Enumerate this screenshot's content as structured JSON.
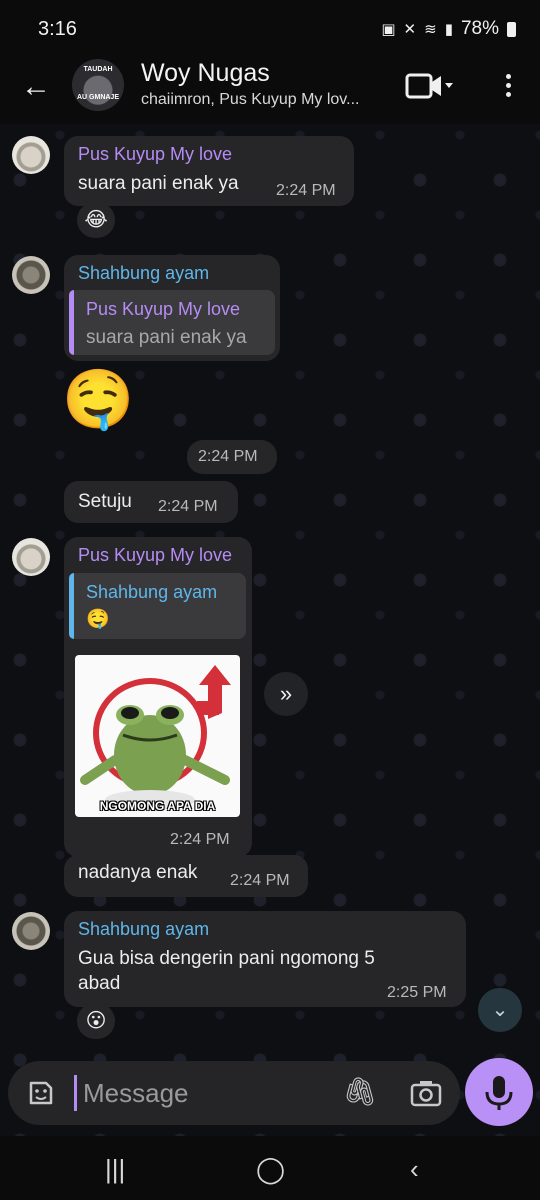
{
  "status": {
    "time": "3:16",
    "battery": "78%"
  },
  "header": {
    "title": "Woy Nugas",
    "subtitle": "chaiimron, Pus Kuyup My lov...",
    "avatar_top": "TAUDAH",
    "avatar_bottom": "AU GMNAJE"
  },
  "messages": [
    {
      "sender": "Pus Kuyup My love",
      "text": "suara pani enak ya",
      "time": "2:24 PM",
      "reaction": "😂"
    },
    {
      "sender": "Shahbung ayam",
      "reply_sender": "Pus Kuyup My love",
      "reply_text": "suara pani enak ya",
      "emoji": "🤤",
      "time": "2:24 PM"
    },
    {
      "text": "Setuju",
      "time": "2:24 PM"
    },
    {
      "sender": "Pus Kuyup My love",
      "reply_sender": "Shahbung ayam",
      "reply_text": "🤤",
      "image_caption": "NGOMONG APA DIA",
      "time": "2:24 PM"
    },
    {
      "text": "nadanya enak",
      "time": "2:24 PM"
    },
    {
      "sender": "Shahbung ayam",
      "text_line1": "Gua bisa dengerin pani ngomong 5",
      "text_line2": "abad",
      "time": "2:25 PM",
      "reaction": "😮"
    }
  ],
  "composer": {
    "placeholder": "Message"
  },
  "colors": {
    "accent": "#b58cf3",
    "sender_blue": "#5fb6ea",
    "bubble": "#262628"
  }
}
